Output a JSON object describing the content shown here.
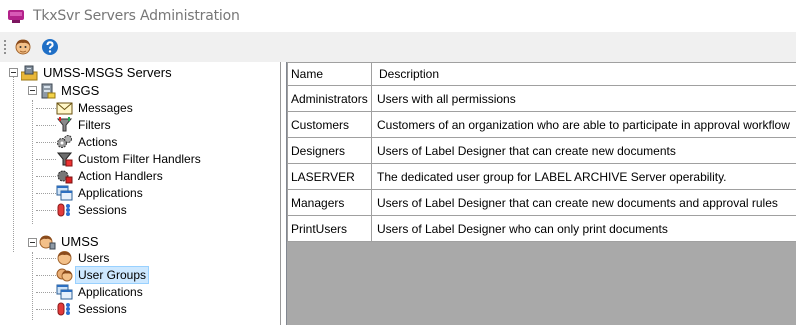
{
  "window": {
    "title": "TkxSvr Servers Administration",
    "icon": "server-admin-app-icon"
  },
  "toolbar": {
    "buttons": [
      {
        "name": "users-tool",
        "icon": "user-face-icon"
      },
      {
        "name": "help",
        "icon": "help-question-icon"
      }
    ]
  },
  "tree": {
    "root": {
      "label": "UMSS-MSGS Servers",
      "icon": "servers-folder-icon"
    },
    "msgs": {
      "label": "MSGS",
      "icon": "server-icon",
      "children": [
        {
          "label": "Messages",
          "icon": "envelope-icon"
        },
        {
          "label": "Filters",
          "icon": "filter-icon"
        },
        {
          "label": "Actions",
          "icon": "gears-icon"
        },
        {
          "label": "Custom Filter Handlers",
          "icon": "custom-filter-icon"
        },
        {
          "label": "Action Handlers",
          "icon": "action-handler-icon"
        },
        {
          "label": "Applications",
          "icon": "applications-icon"
        },
        {
          "label": "Sessions",
          "icon": "sessions-icon"
        }
      ]
    },
    "umss": {
      "label": "UMSS",
      "icon": "user-server-icon",
      "children": [
        {
          "label": "Users",
          "icon": "user-face-icon"
        },
        {
          "label": "User Groups",
          "icon": "user-group-icon",
          "selected": true
        },
        {
          "label": "Applications",
          "icon": "applications-icon"
        },
        {
          "label": "Sessions",
          "icon": "sessions-icon"
        }
      ]
    }
  },
  "grid": {
    "columns": [
      "Name",
      "Description"
    ],
    "rows": [
      {
        "name": "Administrators",
        "description": "Users with all permissions"
      },
      {
        "name": "Customers",
        "description": "Customers of an organization who are able to participate in approval workflow"
      },
      {
        "name": "Designers",
        "description": "Users of Label Designer that can create new documents"
      },
      {
        "name": "LASERVER",
        "description": "The dedicated user group for LABEL ARCHIVE Server operability."
      },
      {
        "name": "Managers",
        "description": "Users of Label Designer that can create new documents and approval rules"
      },
      {
        "name": "PrintUsers",
        "description": "Users of Label Designer who can only print documents"
      }
    ]
  },
  "colors": {
    "selection": "#cde8ff",
    "selection_border": "#99d1ff",
    "empty_grid": "#a9a9a9",
    "toolbar": "#f0f0f0"
  }
}
